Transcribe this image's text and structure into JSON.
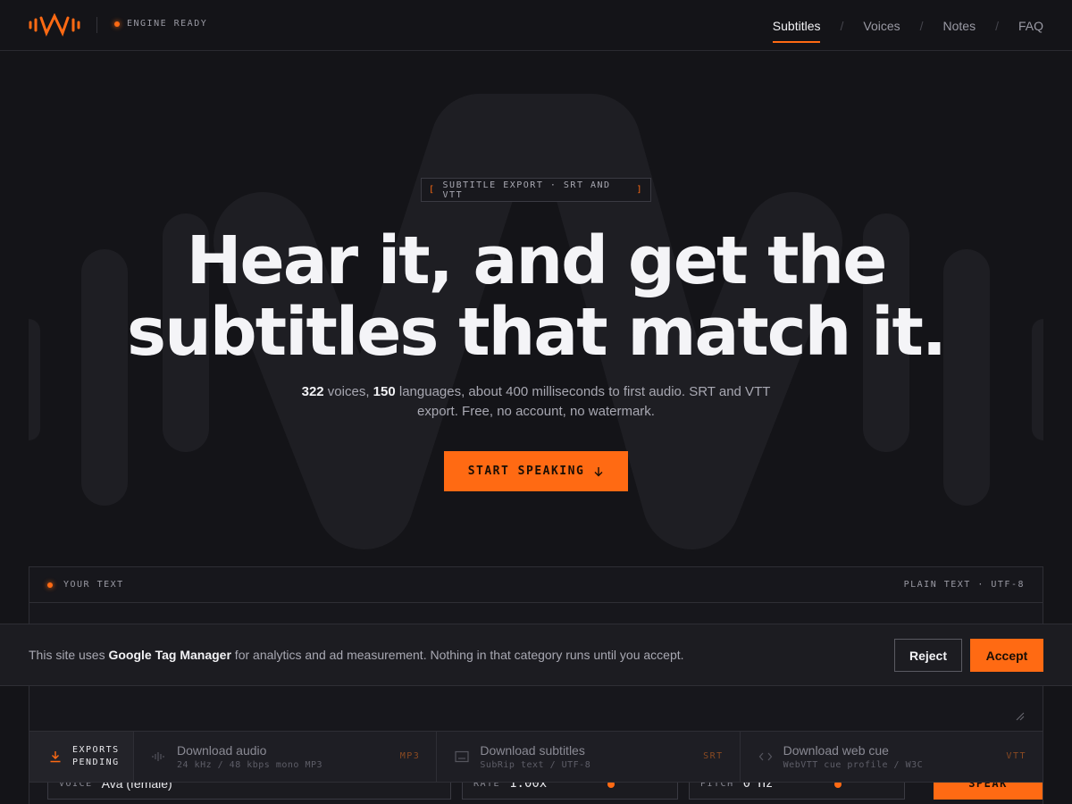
{
  "nav": {
    "status": "ENGINE READY",
    "links": [
      {
        "label": "Subtitles",
        "active": true
      },
      {
        "label": "Voices",
        "active": false
      },
      {
        "label": "Notes",
        "active": false
      },
      {
        "label": "FAQ",
        "active": false
      }
    ]
  },
  "hero": {
    "pill": "SUBTITLE EXPORT · SRT AND VTT",
    "pill_open": "[",
    "pill_close": "]",
    "headline_line1": "Hear it, and get the",
    "headline_line2": "subtitles that match it.",
    "sub_voices_count": "322",
    "sub_voices_text": " voices, ",
    "sub_lang_count": "150",
    "sub_rest": " languages, about 400 milliseconds to first audio. SRT and VTT export. Free, no account, no watermark.",
    "cta_label": "START SPEAKING"
  },
  "panel": {
    "label": "YOUR TEXT",
    "meta": "PLAIN TEXT · UTF-8",
    "controls": {
      "voice_key": "VOICE",
      "voice_value": "Ava (female)",
      "rate_key": "RATE",
      "rate_value": "1.00x",
      "pitch_key": "PITCH",
      "pitch_value": "0 Hz",
      "speak_label": "SPEAK"
    }
  },
  "cookie": {
    "text_before": "This site uses ",
    "text_bold": "Google Tag Manager",
    "text_after": " for analytics and ad measurement. Nothing in that category runs until you accept.",
    "reject": "Reject",
    "accept": "Accept"
  },
  "exports": {
    "status_line1": "EXPORTS",
    "status_line2": "PENDING",
    "items": [
      {
        "title": "Download audio",
        "desc": "24 kHz / 48 kbps mono MP3",
        "format": "MP3",
        "icon": "waveform-icon"
      },
      {
        "title": "Download subtitles",
        "desc": "SubRip text / UTF-8",
        "format": "SRT",
        "icon": "caption-icon"
      },
      {
        "title": "Download web cue",
        "desc": "WebVTT cue profile / W3C",
        "format": "VTT",
        "icon": "code-icon"
      }
    ]
  },
  "colors": {
    "accent": "#ff6a13",
    "background": "#141418"
  }
}
